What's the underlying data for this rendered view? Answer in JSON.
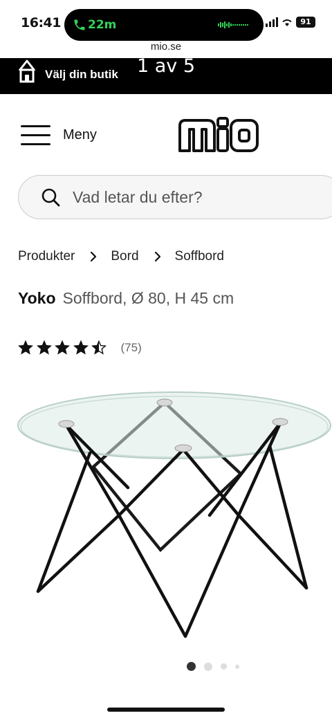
{
  "status_bar": {
    "time": "16:41",
    "call_duration": "22m",
    "battery": "91"
  },
  "browser": {
    "url": "mio.se"
  },
  "store_bar": {
    "label": "Välj din butik",
    "slide_counter": "1 av 5"
  },
  "header": {
    "menu_label": "Meny",
    "logo_text": "mio"
  },
  "search": {
    "placeholder": "Vad letar du efter?"
  },
  "breadcrumb": {
    "items": [
      "Produkter",
      "Bord",
      "Soffbord"
    ]
  },
  "product": {
    "name": "Yoko",
    "description": "Soffbord, Ø 80, H 45 cm",
    "rating": 4.5,
    "max_rating": 5,
    "review_count": "(75)"
  },
  "carousel": {
    "total": 4,
    "active_index": 0
  },
  "colors": {
    "store_bar_bg": "#000000",
    "call_green": "#33d157",
    "star": "#111111"
  },
  "icons": [
    "phone-icon",
    "store-icon",
    "hamburger-icon",
    "search-icon",
    "chevron-right-icon",
    "star-icon"
  ]
}
